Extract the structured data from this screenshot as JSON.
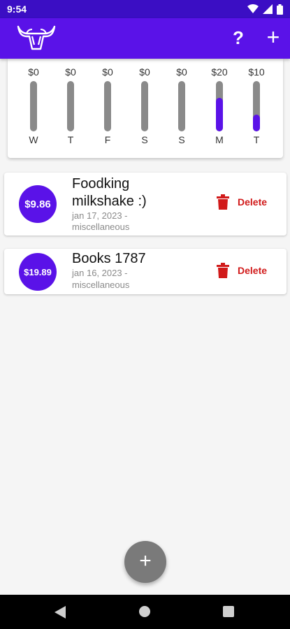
{
  "status_bar": {
    "time": "9:54",
    "icons": [
      "wifi-icon",
      "signal-icon",
      "battery-icon"
    ]
  },
  "app_bar": {
    "logo_icon": "bull-skull-icon",
    "help_label": "?",
    "add_label": "+",
    "color": "#5a12e8"
  },
  "weekly_chart": {
    "days": [
      {
        "amount": "$0",
        "day": "W",
        "fill": 0
      },
      {
        "amount": "$0",
        "day": "T",
        "fill": 0
      },
      {
        "amount": "$0",
        "day": "F",
        "fill": 0
      },
      {
        "amount": "$0",
        "day": "S",
        "fill": 0
      },
      {
        "amount": "$0",
        "day": "S",
        "fill": 0
      },
      {
        "amount": "$20",
        "day": "M",
        "fill": 0.67
      },
      {
        "amount": "$10",
        "day": "T",
        "fill": 0.33
      }
    ]
  },
  "transactions": [
    {
      "amount": "$9.86",
      "title_line1": "Foodking",
      "title_line2": "milkshake :)",
      "date": "jan 17, 2023 -",
      "category": "miscellaneous",
      "delete_label": "Delete"
    },
    {
      "amount": "$19.89",
      "title_line1": "Books 1787",
      "date": "jan 16, 2023 -",
      "category": "miscellaneous",
      "delete_label": "Delete"
    }
  ],
  "fab": {
    "label": "+"
  },
  "nav_bar": {
    "icons": [
      "back-icon",
      "home-icon",
      "recents-icon"
    ]
  }
}
